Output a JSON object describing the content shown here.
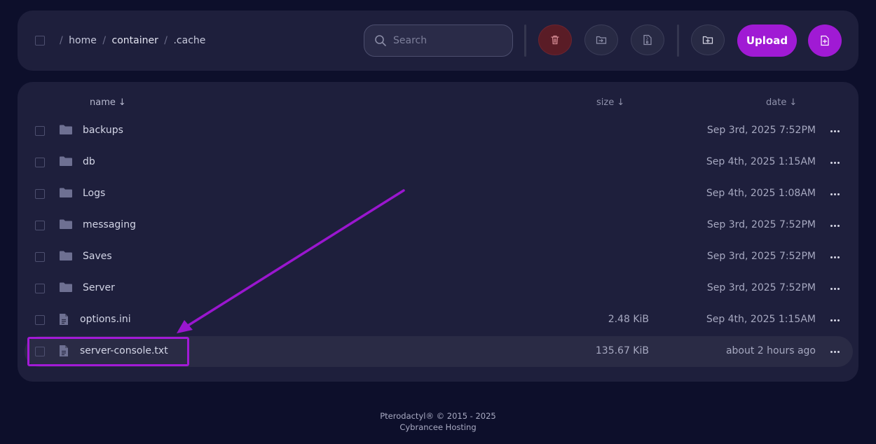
{
  "breadcrumb": {
    "sep": "/",
    "items": [
      "home",
      "container",
      ".cache"
    ]
  },
  "search": {
    "placeholder": "Search"
  },
  "toolbar": {
    "upload_label": "Upload"
  },
  "columns": {
    "name": "name",
    "size": "size",
    "date": "date",
    "sort_arrow": "↓"
  },
  "files": [
    {
      "name": "backups",
      "type": "folder",
      "size": "",
      "date": "Sep 3rd, 2025 7:52PM"
    },
    {
      "name": "db",
      "type": "folder",
      "size": "",
      "date": "Sep 4th, 2025 1:15AM"
    },
    {
      "name": "Logs",
      "type": "folder",
      "size": "",
      "date": "Sep 4th, 2025 1:08AM"
    },
    {
      "name": "messaging",
      "type": "folder",
      "size": "",
      "date": "Sep 3rd, 2025 7:52PM"
    },
    {
      "name": "Saves",
      "type": "folder",
      "size": "",
      "date": "Sep 3rd, 2025 7:52PM"
    },
    {
      "name": "Server",
      "type": "folder",
      "size": "",
      "date": "Sep 3rd, 2025 7:52PM"
    },
    {
      "name": "options.ini",
      "type": "file",
      "size": "2.48 KiB",
      "date": "Sep 4th, 2025 1:15AM"
    },
    {
      "name": "server-console.txt",
      "type": "file",
      "size": "135.67 KiB",
      "date": "about 2 hours ago",
      "highlighted": true
    }
  ],
  "footer": {
    "line1": "Pterodactyl® © 2015 - 2025",
    "line2": "Cybrancee Hosting"
  },
  "colors": {
    "accent": "#a01ad4",
    "background": "#0d0f2b",
    "panel": "#1e1f3c",
    "danger": "#5a1c26"
  },
  "icons": [
    "search-icon",
    "trash-icon",
    "move-folder-icon",
    "archive-icon",
    "new-folder-icon",
    "new-file-icon",
    "folder-icon",
    "file-icon",
    "more-options-icon",
    "annotation-arrow"
  ]
}
